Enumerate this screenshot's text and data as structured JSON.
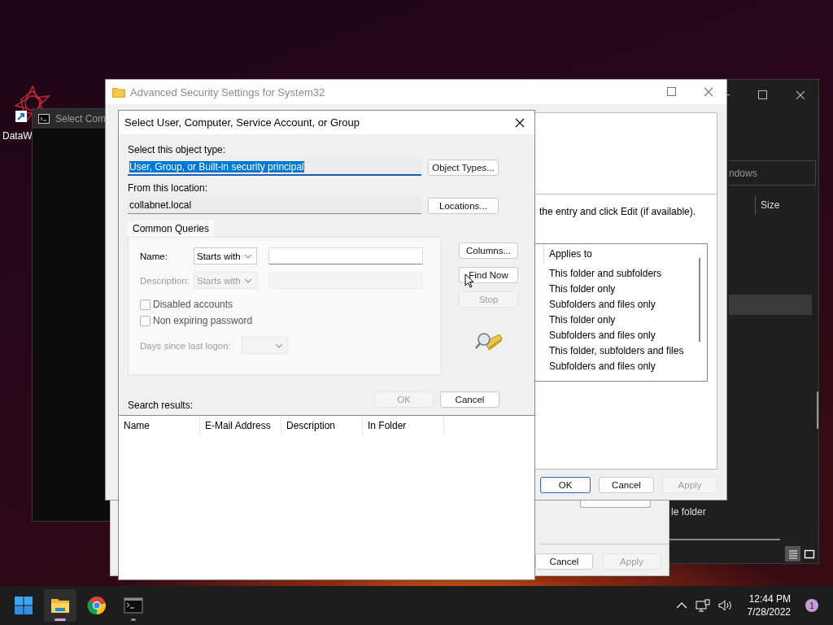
{
  "desktop_icon": {
    "label": "DataW"
  },
  "console_window": {
    "title": "Select Com"
  },
  "explorer_window": {
    "search": {
      "placeholder": "ndows"
    },
    "columns": [
      "Size"
    ],
    "rows": [
      {
        "selected": true
      },
      {
        "label": "le folder",
        "selected": false
      }
    ],
    "view_buttons": [
      {
        "kind": "details",
        "selected": true
      },
      {
        "kind": "tiles",
        "selected": false
      }
    ]
  },
  "properties_window": {
    "buttons": [
      {
        "label": "Cancel",
        "disabled": false
      },
      {
        "label": "Apply",
        "disabled": true
      }
    ]
  },
  "security_window": {
    "title": "Advanced Security Settings for System32",
    "hint": "the entry and click Edit (if available).",
    "list": {
      "columns": [
        "Applies to"
      ],
      "rows": [
        "This folder and subfolders",
        "This folder only",
        "Subfolders and files only",
        "This folder only",
        "Subfolders and files only",
        "This folder, subfolders and files",
        "Subfolders and files only"
      ]
    },
    "buttons": [
      {
        "label": "OK",
        "default": true,
        "disabled": false
      },
      {
        "label": "Cancel",
        "default": false,
        "disabled": false
      },
      {
        "label": "Apply",
        "default": false,
        "disabled": true
      }
    ]
  },
  "dialog": {
    "title": "Select User, Computer, Service Account, or Group",
    "object_type": {
      "label": "Select this object type:",
      "value": "User, Group, or Built-in security principal",
      "selected": true,
      "button": "Object Types..."
    },
    "location": {
      "label": "From this location:",
      "value": "collabnet.local",
      "button": "Locations..."
    },
    "query_tabs": [
      {
        "label": "Common Queries",
        "selected": true
      }
    ],
    "queries": [
      {
        "kind": "text",
        "label": "Name:",
        "operator": "Starts with",
        "disabled": false
      },
      {
        "kind": "text",
        "label": "Description:",
        "operator": "Starts with",
        "disabled": true
      },
      {
        "kind": "checkbox",
        "label": "Disabled accounts",
        "checked": false
      },
      {
        "kind": "checkbox",
        "label": "Non expiring password",
        "checked": false
      },
      {
        "kind": "days",
        "label": "Days since last logon:",
        "disabled": true
      }
    ],
    "side_buttons": [
      {
        "label": "Columns...",
        "disabled": false
      },
      {
        "label": "Find Now",
        "disabled": false
      },
      {
        "label": "Stop",
        "disabled": true
      }
    ],
    "buttons": [
      {
        "label": "OK",
        "disabled": true
      },
      {
        "label": "Cancel",
        "disabled": false
      }
    ],
    "results": {
      "label": "Search results:",
      "columns": [
        "Name",
        "E-Mail Address",
        "Description",
        "In Folder"
      ]
    }
  },
  "taskbar": {
    "apps": [
      {
        "kind": "start",
        "selected": false,
        "running": false
      },
      {
        "kind": "folder",
        "selected": true,
        "running": true
      },
      {
        "kind": "browser",
        "selected": false,
        "running": false
      },
      {
        "kind": "terminal",
        "selected": false,
        "running": true
      }
    ],
    "time": "12:44 PM",
    "date": "7/28/2022",
    "notification_count": "1"
  }
}
